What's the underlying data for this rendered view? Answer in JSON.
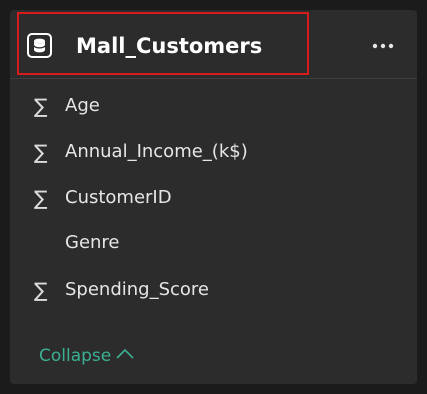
{
  "table": {
    "icon": "database-icon",
    "name": "Mall_Customers",
    "more_icon": "more-options-icon",
    "highlight_color": "#d81b1b"
  },
  "fields": [
    {
      "name": "Age",
      "icon": "sigma-icon",
      "aggregated": true
    },
    {
      "name": "Annual_Income_(k$)",
      "icon": "sigma-icon",
      "aggregated": true
    },
    {
      "name": "CustomerID",
      "icon": "sigma-icon",
      "aggregated": true
    },
    {
      "name": "Genre",
      "icon": "",
      "aggregated": false
    },
    {
      "name": "Spending_Score",
      "icon": "sigma-icon",
      "aggregated": true
    }
  ],
  "footer": {
    "collapse_label": "Collapse",
    "collapse_icon": "chevron-up-icon",
    "accent_color": "#3bb093"
  }
}
